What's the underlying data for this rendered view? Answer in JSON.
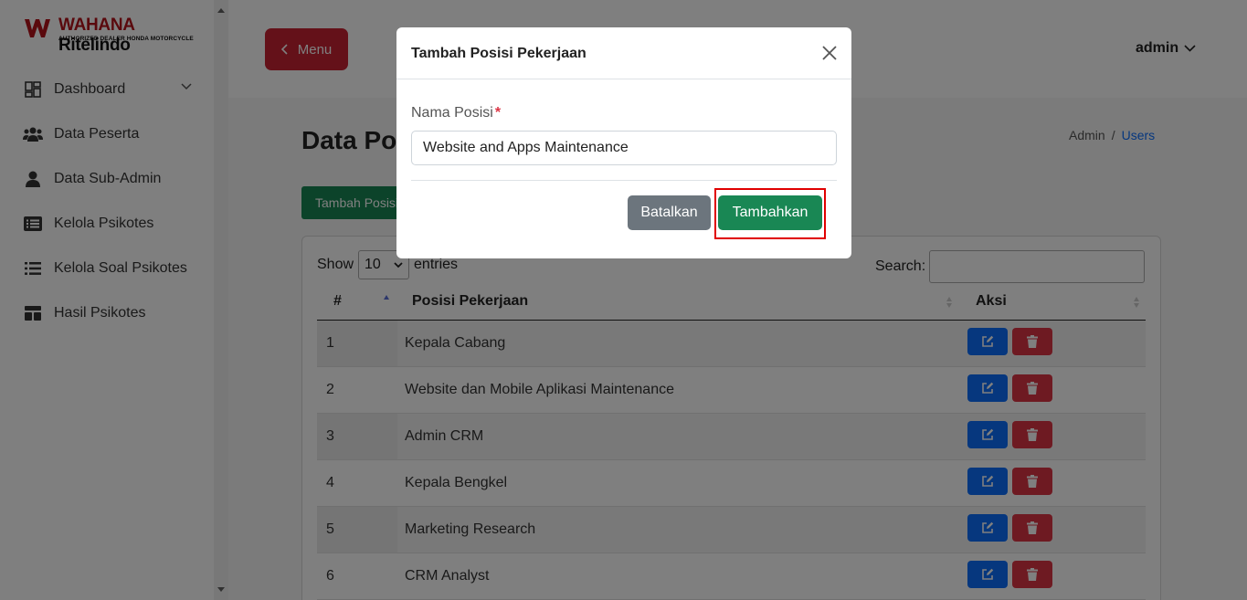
{
  "sidebar": {
    "brand_a": "WAHANA",
    "brand_b": "Ritelindo",
    "tagline": "AUTHORIZED DEALER HONDA MOTORCYCLE",
    "items": [
      {
        "label": "Dashboard",
        "icon": "dashboard-icon"
      },
      {
        "label": "Data Peserta",
        "icon": "users-icon"
      },
      {
        "label": "Data Sub-Admin",
        "icon": "user-icon"
      },
      {
        "label": "Kelola Psikotes",
        "icon": "list-alt-icon"
      },
      {
        "label": "Kelola Soal Psikotes",
        "icon": "list-icon"
      },
      {
        "label": "Hasil Psikotes",
        "icon": "table-icon"
      }
    ]
  },
  "header": {
    "menu_label": "Menu",
    "user": "admin"
  },
  "page": {
    "title": "Data Posisi Pekerjaan",
    "breadcrumb": [
      "Admin",
      "Users"
    ],
    "add_button": "Tambah Posisi Pekerjaan"
  },
  "table": {
    "show_label": "Show",
    "page_size": "10",
    "entries_label": "entries",
    "search_label": "Search:",
    "columns": [
      "#",
      "Posisi Pekerjaan",
      "Aksi"
    ],
    "rows": [
      {
        "no": "1",
        "name": "Kepala Cabang"
      },
      {
        "no": "2",
        "name": "Website dan Mobile Aplikasi Maintenance"
      },
      {
        "no": "3",
        "name": "Admin CRM"
      },
      {
        "no": "4",
        "name": "Kepala Bengkel"
      },
      {
        "no": "5",
        "name": "Marketing Research"
      },
      {
        "no": "6",
        "name": "CRM Analyst"
      }
    ]
  },
  "modal": {
    "title": "Tambah Posisi Pekerjaan",
    "field_label": "Nama Posisi",
    "required_mark": "*",
    "field_value": "Website and Apps Maintenance",
    "cancel_label": "Batalkan",
    "submit_label": "Tambahkan"
  },
  "colors": {
    "primary": "#0d6efd",
    "danger": "#dc3545",
    "success": "#198754",
    "secondary": "#6c757d",
    "highlight": "#e00000"
  }
}
